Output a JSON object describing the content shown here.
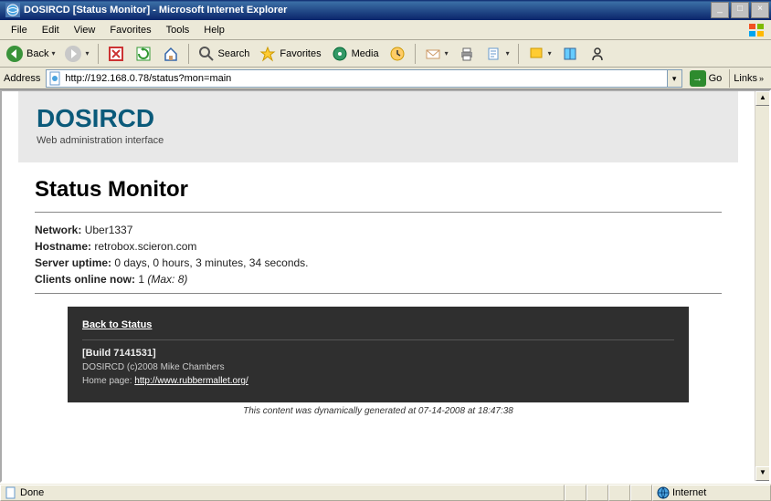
{
  "window": {
    "title": "DOSIRCD [Status Monitor] - Microsoft Internet Explorer"
  },
  "menu": {
    "file": "File",
    "edit": "Edit",
    "view": "View",
    "favorites": "Favorites",
    "tools": "Tools",
    "help": "Help"
  },
  "toolbar": {
    "back": "Back",
    "search": "Search",
    "favorites": "Favorites",
    "media": "Media"
  },
  "address": {
    "label": "Address",
    "value": "http://192.168.0.78/status?mon=main",
    "go": "Go",
    "links": "Links"
  },
  "page": {
    "brand": "DOSIRCD",
    "brand_sub": "Web administration interface",
    "heading": "Status Monitor",
    "network_label": "Network:",
    "network_value": "Uber1337",
    "hostname_label": "Hostname:",
    "hostname_value": "retrobox.scieron.com",
    "uptime_label": "Server uptime:",
    "uptime_value": "0 days, 0 hours, 3 minutes, 34 seconds.",
    "clients_label": "Clients online now:",
    "clients_value": "1",
    "clients_max": "(Max: 8)",
    "back_link": "Back to Status",
    "build": "[Build 7141531]",
    "copyright": "DOSIRCD (c)2008 Mike Chambers",
    "homepage_label": "Home page:",
    "homepage_url": "http://www.rubbermallet.org/",
    "generated": "This content was dynamically generated at 07-14-2008 at 18:47:38"
  },
  "status": {
    "done": "Done",
    "zone": "Internet"
  }
}
